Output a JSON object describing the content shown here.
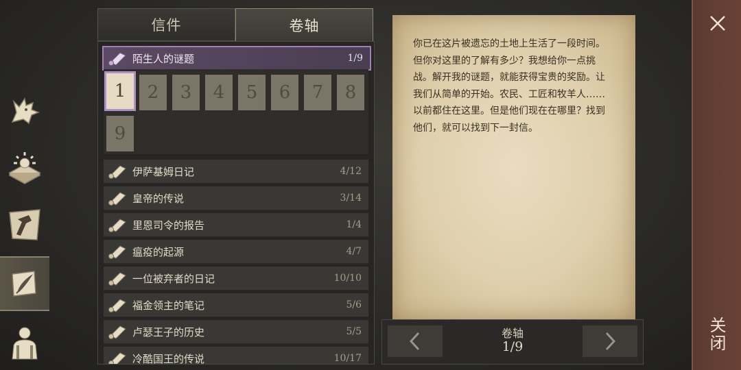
{
  "tabs": [
    {
      "label": "信件",
      "active": false
    },
    {
      "label": "卷轴",
      "active": true
    }
  ],
  "side_nav": [
    {
      "icon": "wolf-icon",
      "active": false
    },
    {
      "icon": "sun-book-icon",
      "active": false
    },
    {
      "icon": "hammer-icon",
      "active": false
    },
    {
      "icon": "quill-scroll-icon",
      "active": true
    },
    {
      "icon": "character-icon",
      "active": false
    }
  ],
  "selected_entry": {
    "title": "陌生人的谜题",
    "count": "1/9"
  },
  "pages": [
    "1",
    "2",
    "3",
    "4",
    "5",
    "6",
    "7",
    "8",
    "9"
  ],
  "active_page": "1",
  "entries": [
    {
      "title": "伊萨基姆日记",
      "count": "4/12"
    },
    {
      "title": "皇帝的传说",
      "count": "3/14"
    },
    {
      "title": "里恩司令的报告",
      "count": "1/4"
    },
    {
      "title": "瘟疫的起源",
      "count": "4/7"
    },
    {
      "title": "一位被弃者的日记",
      "count": "10/10"
    },
    {
      "title": "福金领主的笔记",
      "count": "5/6"
    },
    {
      "title": "卢瑟王子的历史",
      "count": "5/5"
    },
    {
      "title": "冷酷国王的传说",
      "count": "10/17"
    }
  ],
  "parchment_text": "你已在这片被遗忘的土地上生活了一段时间。但你对这里的了解有多少？我想给你一点挑战。解开我的谜题，就能获得宝贵的奖励。让我们从简单的开始。农民、工匠和牧羊人……以前都住在这里。但是他们现在在哪里？找到他们，就可以找到下一封信。",
  "pager": {
    "label": "卷轴",
    "value": "1/9"
  },
  "close": {
    "label": "关闭"
  }
}
